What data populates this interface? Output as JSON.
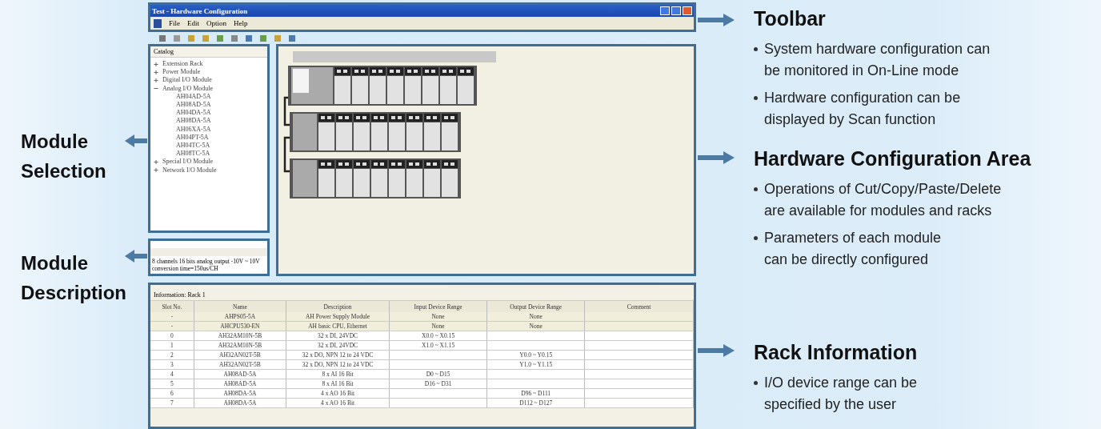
{
  "window": {
    "title": "Test - Hardware Configuration"
  },
  "menu": [
    "File",
    "Edit",
    "Option",
    "Help"
  ],
  "catalog": {
    "title": "Catalog",
    "items": [
      {
        "label": "Extension Rack",
        "expanded": false
      },
      {
        "label": "Power Module",
        "expanded": false
      },
      {
        "label": "Digital I/O Module",
        "expanded": false
      },
      {
        "label": "Analog I/O Module",
        "expanded": true,
        "children": [
          "AH04AD-5A",
          "AH08AD-5A",
          "AH04DA-5A",
          "AH08DA-5A",
          "AH06XA-5A",
          "AH04PT-5A",
          "AH04TC-5A",
          "AH08TC-5A"
        ]
      },
      {
        "label": "Special I/O Module",
        "expanded": false
      },
      {
        "label": "Network I/O Module",
        "expanded": false
      }
    ]
  },
  "description": {
    "text": "8 channels 16 bits analog output -10V ~ 10V conversion time=150us/CH"
  },
  "rack_info": {
    "title": "Information: Rack 1",
    "columns": [
      "Slot No.",
      "Name",
      "Description",
      "Input Device Range",
      "Output Device Range",
      "Comment"
    ],
    "rows": [
      {
        "kind": "system",
        "cells": [
          "-",
          "AHPS05-5A",
          "AH Power Supply Module",
          "None",
          "None",
          ""
        ]
      },
      {
        "kind": "system",
        "cells": [
          "-",
          "AHCPU530-EN",
          "AH basic CPU, Ethernet",
          "None",
          "None",
          ""
        ]
      },
      {
        "kind": "io",
        "cells": [
          "0",
          "AH32AM10N-5B",
          "32 x DI, 24VDC",
          "X0.0 ~ X0.15",
          "",
          ""
        ]
      },
      {
        "kind": "io",
        "cells": [
          "1",
          "AH32AM10N-5B",
          "32 x DI, 24VDC",
          "X1.0 ~ X1.15",
          "",
          ""
        ]
      },
      {
        "kind": "io",
        "cells": [
          "2",
          "AH32AN02T-5B",
          "32 x DO, NPN 12 to 24 VDC",
          "",
          "Y0.0 ~ Y0.15",
          ""
        ]
      },
      {
        "kind": "io",
        "cells": [
          "3",
          "AH32AN02T-5B",
          "32 x DO, NPN 12 to 24 VDC",
          "",
          "Y1.0 ~ Y1.15",
          ""
        ]
      },
      {
        "kind": "io",
        "cells": [
          "4",
          "AH08AD-5A",
          "8 x AI 16 Bit",
          "D0 ~ D15",
          "",
          ""
        ]
      },
      {
        "kind": "io",
        "cells": [
          "5",
          "AH08AD-5A",
          "8 x AI 16 Bit",
          "D16 ~ D31",
          "",
          ""
        ]
      },
      {
        "kind": "io",
        "cells": [
          "6",
          "AH08DA-5A",
          "4 x AO 16 Bit",
          "",
          "D96 ~ D111",
          ""
        ]
      },
      {
        "kind": "io",
        "cells": [
          "7",
          "AH08DA-5A",
          "4 x AO 16 Bit",
          "",
          "D112 ~ D127",
          ""
        ]
      }
    ]
  },
  "callouts_left": [
    "Module Selection",
    "Module Description"
  ],
  "callouts_right": [
    {
      "title": "Toolbar",
      "bullets": [
        "System hardware configuration can\nbe monitored in On-Line mode",
        "Hardware configuration can be\ndisplayed by Scan function"
      ]
    },
    {
      "title": "Hardware Configuration Area",
      "bullets": [
        "Operations of Cut/Copy/Paste/Delete\nare available for modules and racks",
        "Parameters of each module\ncan be directly configured"
      ]
    },
    {
      "title": "Rack Information",
      "bullets": [
        "I/O device range can be\nspecified by the user"
      ]
    }
  ]
}
